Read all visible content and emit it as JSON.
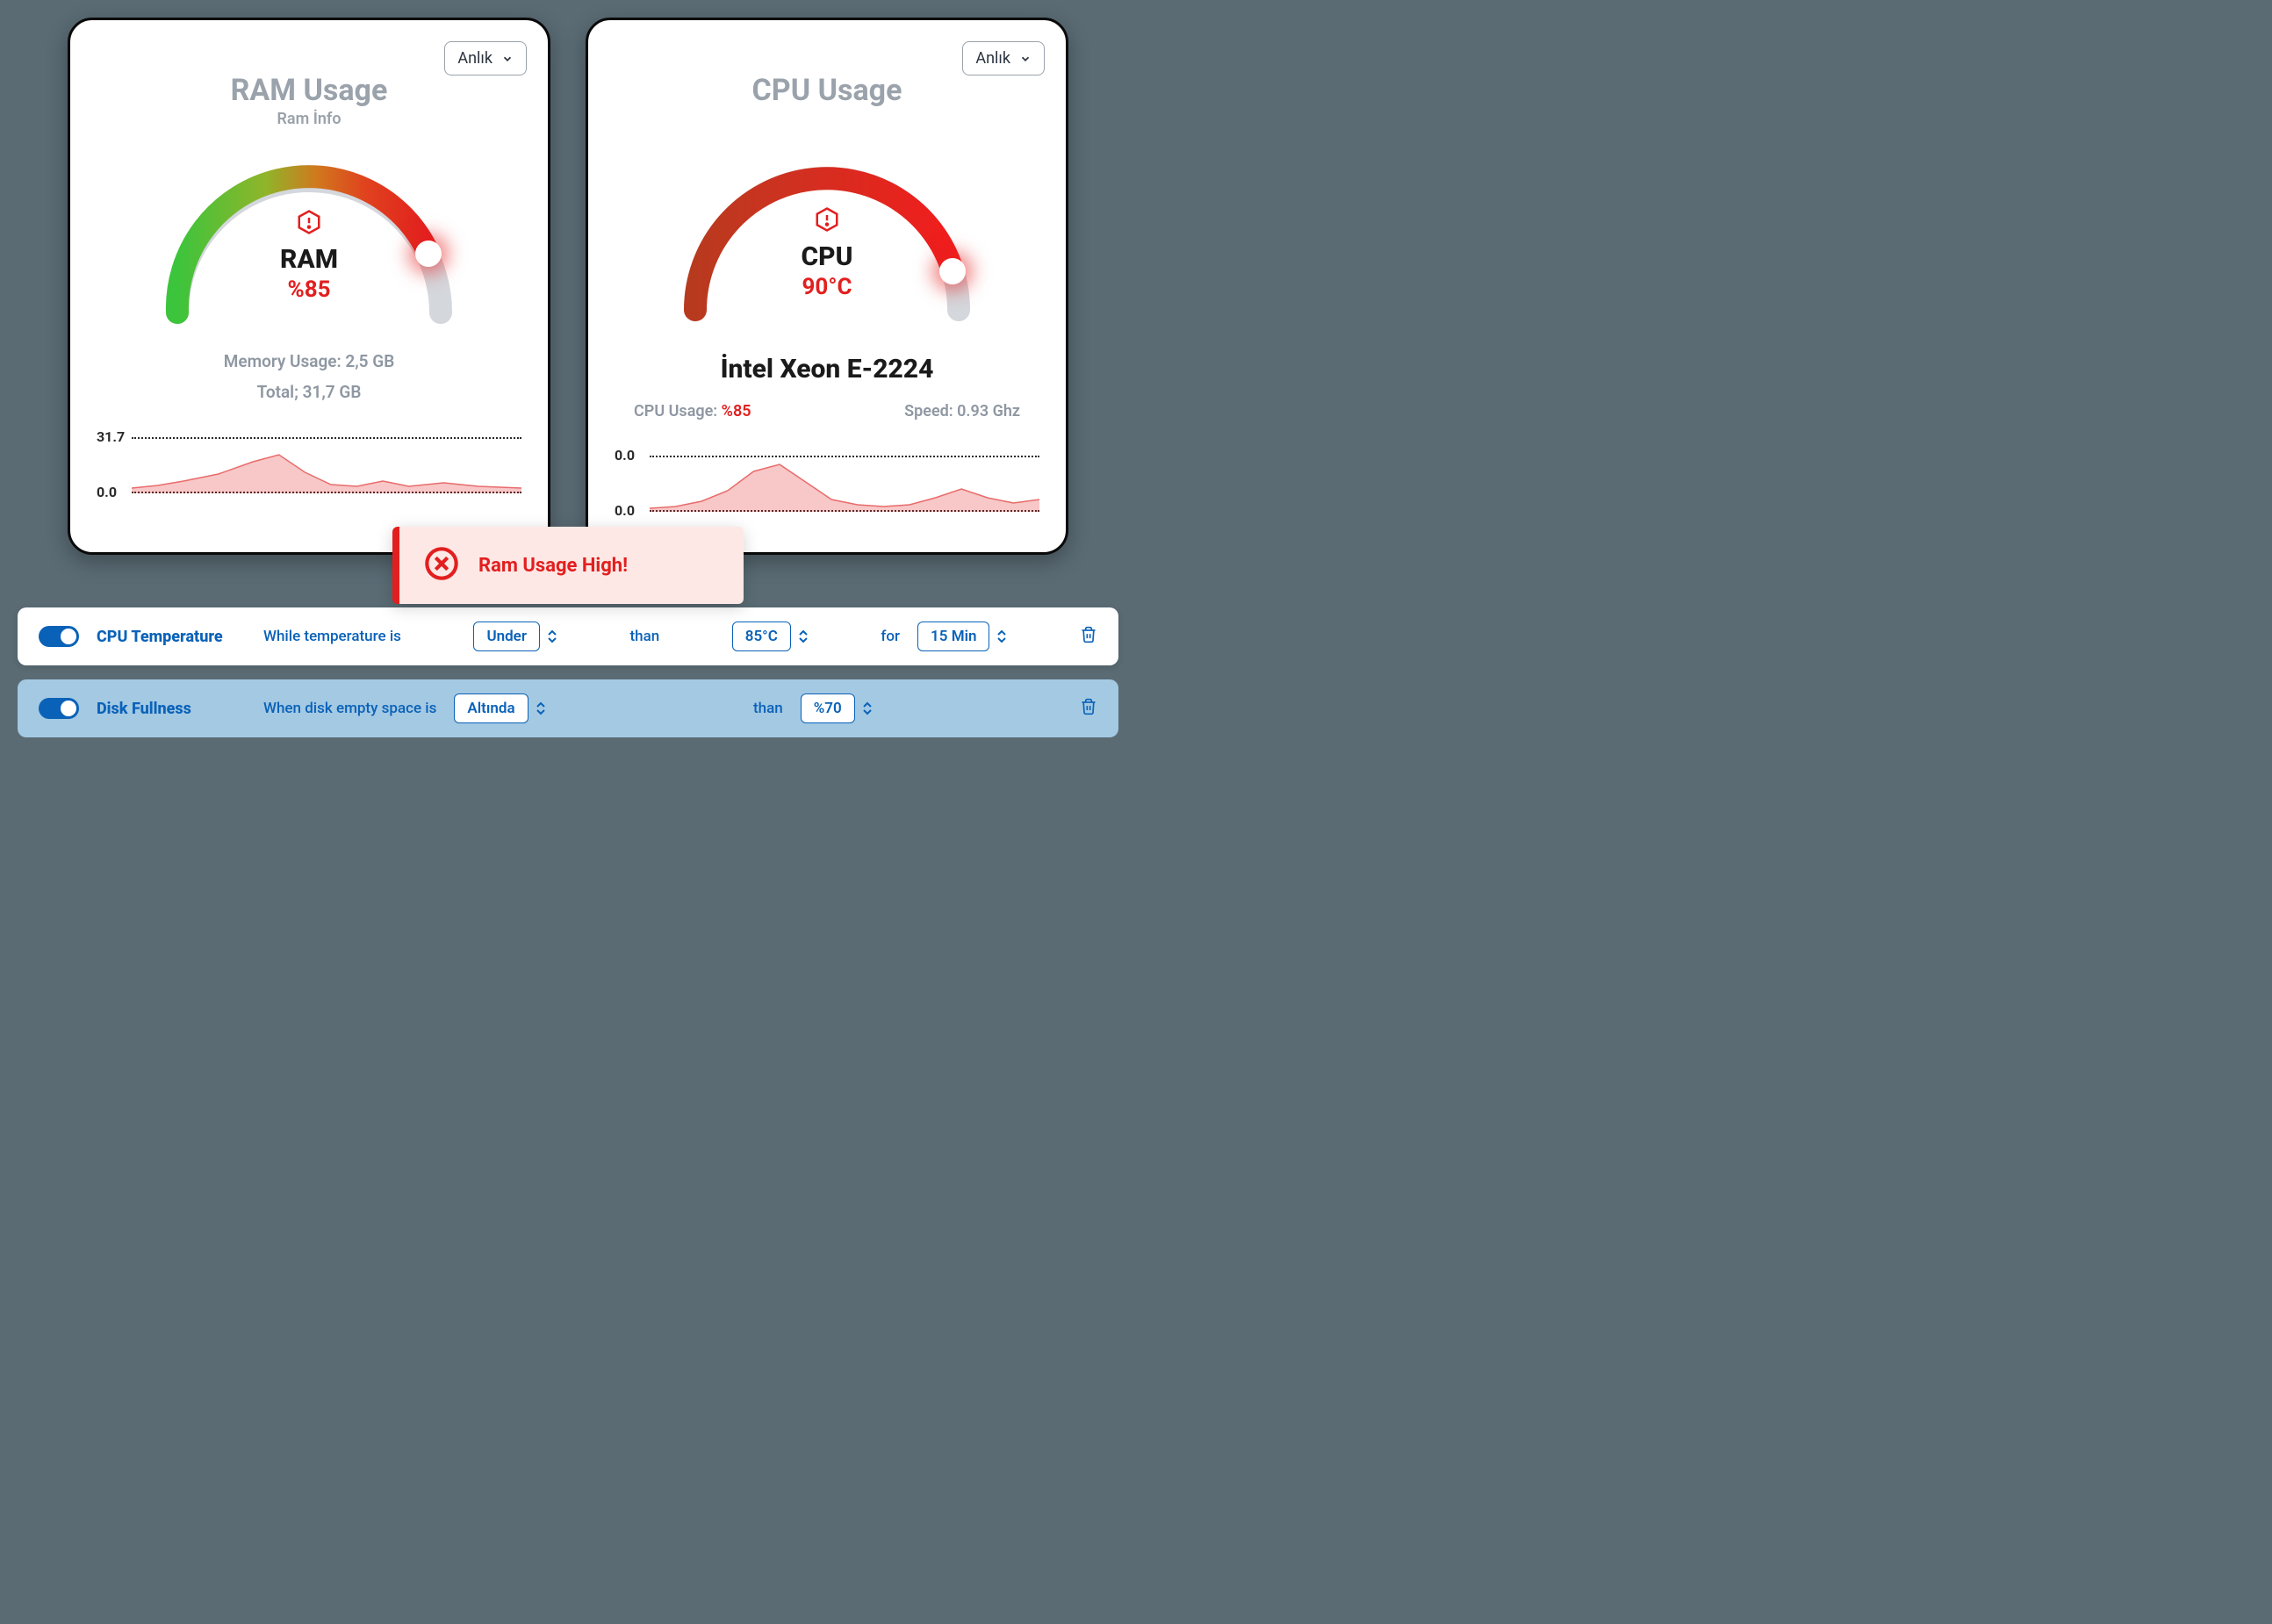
{
  "ram_card": {
    "dropdown": "Anlık",
    "title": "RAM Usage",
    "subtitle": "Ram İnfo",
    "gauge_label": "RAM",
    "gauge_value": "%85",
    "memory_usage": "Memory Usage: 2,5 GB",
    "total": "Total; 31,7 GB",
    "y_top": "31.7",
    "y_bot": "0.0"
  },
  "cpu_card": {
    "dropdown": "Anlık",
    "title": "CPU Usage",
    "gauge_label": "CPU",
    "gauge_value": "90°C",
    "cpu_name": "İntel Xeon E-2224",
    "usage_label": "CPU Usage: ",
    "usage_value": "%85",
    "speed": "Speed: 0.93 Ghz",
    "y_top": "0.0",
    "y_bot": "0.0"
  },
  "alert": {
    "text": "Ram Usage High!"
  },
  "rule1": {
    "title": "CPU Temperature",
    "text1": "While temperature is",
    "select1": "Under",
    "text2": "than",
    "select2": "85°C",
    "text3": "for",
    "select3": "15 Min"
  },
  "rule2": {
    "title": "Disk Fullness",
    "text1": "When disk empty space is",
    "select1": "Altında",
    "text2": "than",
    "select2": "%70"
  },
  "chart_data": [
    {
      "type": "gauge",
      "title": "RAM Usage",
      "value": 85,
      "unit": "%",
      "range": [
        0,
        100
      ]
    },
    {
      "type": "gauge",
      "title": "CPU Usage",
      "value": 90,
      "unit": "°C",
      "range": [
        0,
        100
      ]
    },
    {
      "type": "area",
      "title": "RAM sparkline",
      "ylim": [
        0,
        31.7
      ],
      "x": [
        0,
        1,
        2,
        3,
        4,
        5,
        6,
        7,
        8,
        9,
        10,
        11,
        12
      ],
      "values": [
        2,
        3,
        5,
        10,
        14,
        8,
        4,
        3,
        4,
        3,
        2,
        3,
        2
      ]
    },
    {
      "type": "area",
      "title": "CPU sparkline",
      "ylim": [
        0,
        31.7
      ],
      "x": [
        0,
        1,
        2,
        3,
        4,
        5,
        6,
        7,
        8,
        9,
        10,
        11,
        12
      ],
      "values": [
        1,
        2,
        4,
        12,
        18,
        10,
        4,
        3,
        2,
        2,
        5,
        8,
        4
      ]
    }
  ]
}
